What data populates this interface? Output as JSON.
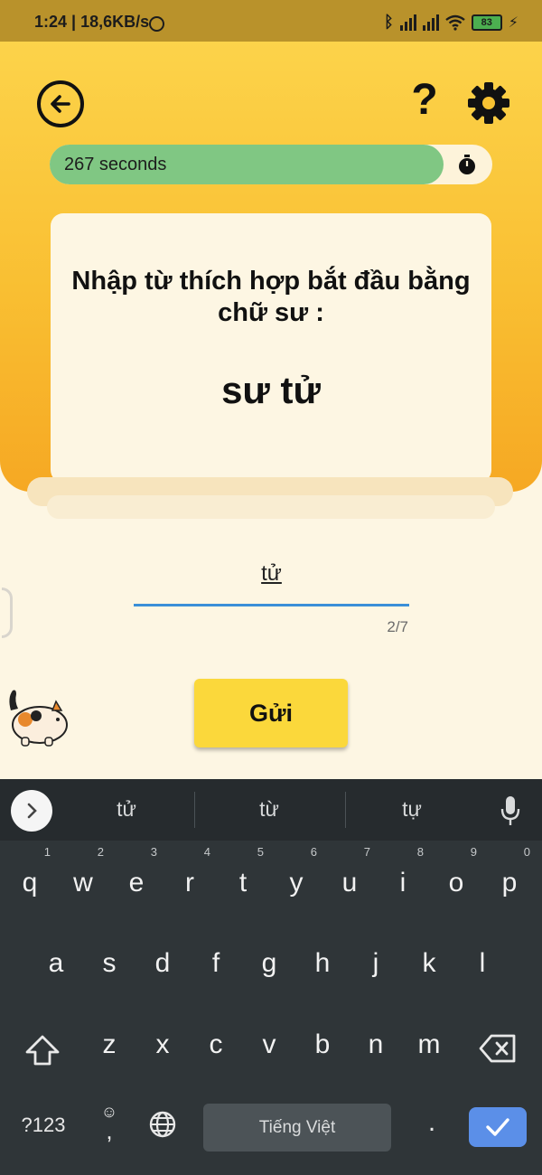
{
  "status_bar": {
    "time": "1:24 | 18,6KB/s",
    "bluetooth_icon": "bluetooth-icon",
    "battery_level": "83"
  },
  "header": {
    "back_icon": "arrow-left-icon",
    "help_label": "?",
    "settings_icon": "gear-icon"
  },
  "timer": {
    "label": "267 seconds",
    "remaining_fraction": 0.89,
    "fill_color": "#80c783"
  },
  "question": {
    "prompt": "Nhập từ thích hợp bắt đầu bằng chữ sư :",
    "example": "sư tử"
  },
  "answer": {
    "value": "tử",
    "counter": "2/7"
  },
  "submit": {
    "label": "Gửi",
    "color": "#fbd83b"
  },
  "keyboard": {
    "suggestions": [
      "tử",
      "từ",
      "tự"
    ],
    "row1": [
      {
        "k": "q",
        "h": "1"
      },
      {
        "k": "w",
        "h": "2"
      },
      {
        "k": "e",
        "h": "3"
      },
      {
        "k": "r",
        "h": "4"
      },
      {
        "k": "t",
        "h": "5"
      },
      {
        "k": "y",
        "h": "6"
      },
      {
        "k": "u",
        "h": "7"
      },
      {
        "k": "i",
        "h": "8"
      },
      {
        "k": "o",
        "h": "9"
      },
      {
        "k": "p",
        "h": "0"
      }
    ],
    "row2": [
      "a",
      "s",
      "d",
      "f",
      "g",
      "h",
      "j",
      "k",
      "l"
    ],
    "row3": [
      "z",
      "x",
      "c",
      "v",
      "b",
      "n",
      "m"
    ],
    "symbols_label": "?123",
    "emoji_label": "☺",
    "comma_label": ",",
    "space_label": "Tiếng Việt",
    "period_label": ".",
    "accent_color": "#5b8fe8"
  }
}
